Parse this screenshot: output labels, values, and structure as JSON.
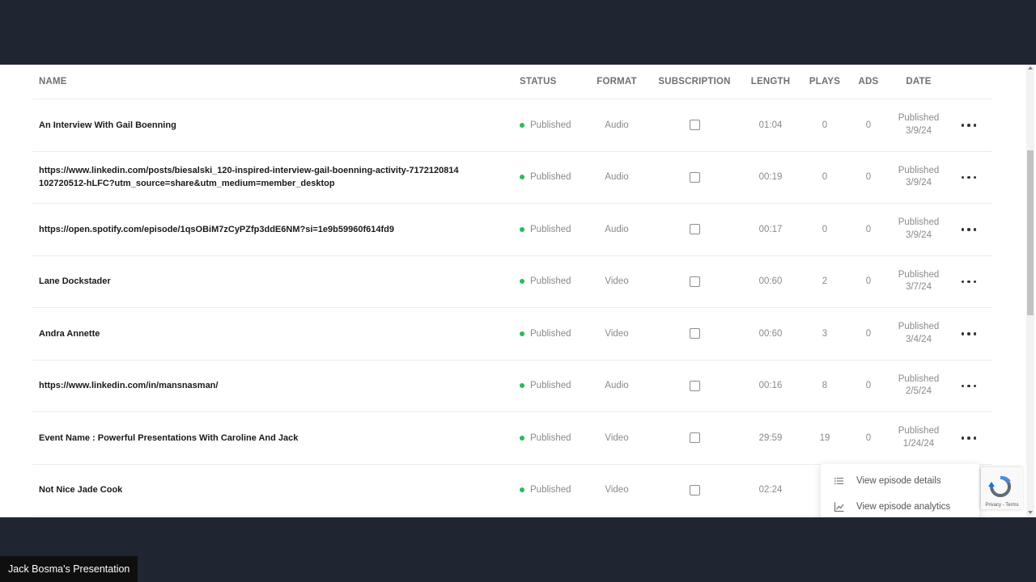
{
  "table": {
    "headers": {
      "name": "NAME",
      "status": "STATUS",
      "format": "FORMAT",
      "subscription": "SUBSCRIPTION",
      "length": "LENGTH",
      "plays": "PLAYS",
      "ads": "ADS",
      "date": "DATE"
    },
    "rows": [
      {
        "name": "An Interview With Gail Boenning",
        "status": "Published",
        "format": "Audio",
        "length": "01:04",
        "plays": "0",
        "ads": "0",
        "date_status": "Published",
        "date": "3/9/24"
      },
      {
        "name": "https://www.linkedin.com/posts/biesalski_120-inspired-interview-gail-boenning-activity-7172120814102720512-hLFC?utm_source=share&utm_medium=member_desktop",
        "status": "Published",
        "format": "Audio",
        "length": "00:19",
        "plays": "0",
        "ads": "0",
        "date_status": "Published",
        "date": "3/9/24"
      },
      {
        "name": "https://open.spotify.com/episode/1qsOBiM7zCyPZfp3ddE6NM?si=1e9b59960f614fd9",
        "status": "Published",
        "format": "Audio",
        "length": "00:17",
        "plays": "0",
        "ads": "0",
        "date_status": "Published",
        "date": "3/9/24"
      },
      {
        "name": "Lane Dockstader",
        "status": "Published",
        "format": "Video",
        "length": "00:60",
        "plays": "2",
        "ads": "0",
        "date_status": "Published",
        "date": "3/7/24"
      },
      {
        "name": "Andra Annette",
        "status": "Published",
        "format": "Video",
        "length": "00:60",
        "plays": "3",
        "ads": "0",
        "date_status": "Published",
        "date": "3/4/24"
      },
      {
        "name": "https://www.linkedin.com/in/mansnasman/",
        "status": "Published",
        "format": "Audio",
        "length": "00:16",
        "plays": "8",
        "ads": "0",
        "date_status": "Published",
        "date": "2/5/24"
      },
      {
        "name": "Event Name : Powerful Presentations With Caroline And Jack",
        "status": "Published",
        "format": "Video",
        "length": "29:59",
        "plays": "19",
        "ads": "0",
        "date_status": "Published",
        "date": "1/24/24"
      },
      {
        "name": "Not Nice Jade Cook",
        "status": "Published",
        "format": "Video",
        "length": "02:24",
        "plays": "",
        "ads": "",
        "date_status": "",
        "date": ""
      }
    ]
  },
  "context_menu": {
    "items": [
      {
        "label": "View episode details",
        "icon": "list-icon"
      },
      {
        "label": "View episode analytics",
        "icon": "chart-icon"
      }
    ]
  },
  "recaptcha": {
    "text": "Privacy - Terms"
  },
  "presenter": {
    "label": "Jack Bosma's Presentation"
  },
  "colors": {
    "status_published": "#2eb85c",
    "background": "#1f2631"
  }
}
